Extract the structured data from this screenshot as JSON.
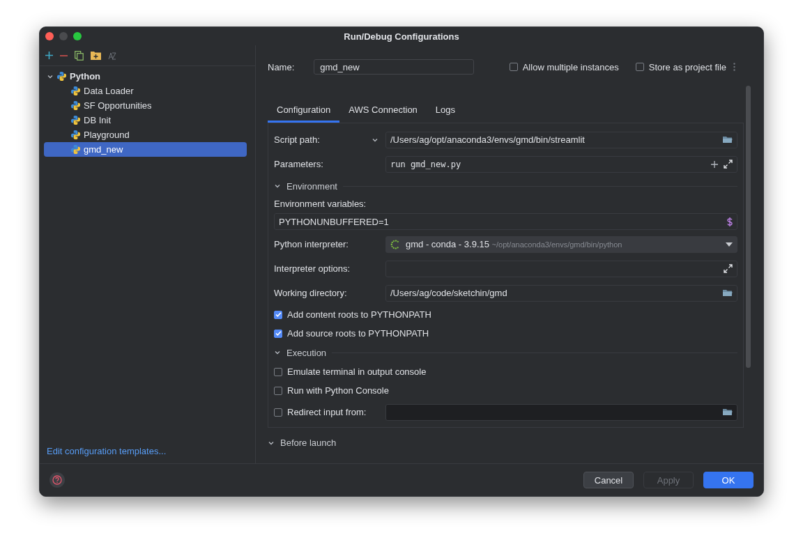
{
  "window": {
    "title": "Run/Debug Configurations"
  },
  "tree": [
    {
      "label": "Python",
      "expanded": true,
      "children": [
        {
          "label": "Data Loader",
          "selected": false
        },
        {
          "label": "SF Opportunities",
          "selected": false
        },
        {
          "label": "DB Init",
          "selected": false
        },
        {
          "label": "Playground",
          "selected": false
        },
        {
          "label": "gmd_new",
          "selected": true
        }
      ]
    }
  ],
  "templates_link": "Edit configuration templates...",
  "name_field": {
    "label": "Name:",
    "value": "gmd_new"
  },
  "options": [
    {
      "label": "Allow multiple instances",
      "checked": false
    },
    {
      "label": "Store as project file",
      "checked": false
    }
  ],
  "tabs": [
    {
      "label": "Configuration",
      "selected": true
    },
    {
      "label": "AWS Connection",
      "selected": false
    },
    {
      "label": "Logs",
      "selected": false
    }
  ],
  "form": [
    {
      "kind": "script",
      "label": "Script path:",
      "value": "/Users/ag/opt/anaconda3/envs/gmd/bin/streamlit"
    },
    {
      "kind": "params",
      "label": "Parameters:",
      "value": "run gmd_new.py"
    },
    {
      "kind": "section",
      "label": "Environment",
      "expanded": true
    },
    {
      "kind": "caption",
      "label": "Environment variables:"
    },
    {
      "kind": "env",
      "value": "PYTHONUNBUFFERED=1"
    },
    {
      "kind": "interpreter",
      "label": "Python interpreter:",
      "value": "gmd - conda - 3.9.15",
      "detail": "~/opt/anaconda3/envs/gmd/bin/python"
    },
    {
      "kind": "expand",
      "label": "Interpreter options:"
    },
    {
      "kind": "path",
      "label": "Working directory:",
      "value": "/Users/ag/code/sketchin/gmd"
    },
    {
      "kind": "check",
      "label": "Add content roots to PYTHONPATH",
      "checked": true
    },
    {
      "kind": "check",
      "label": "Add source roots to PYTHONPATH",
      "checked": true
    },
    {
      "kind": "section",
      "label": "Execution",
      "expanded": true
    },
    {
      "kind": "check",
      "label": "Emulate terminal in output console",
      "checked": false
    },
    {
      "kind": "check",
      "label": "Run with Python Console",
      "checked": false
    },
    {
      "kind": "checkpath",
      "label": "Redirect input from:",
      "checked": false
    }
  ],
  "after_section": {
    "label": "Before launch",
    "expanded": true
  },
  "buttons": [
    {
      "label": "Cancel",
      "kind": "default"
    },
    {
      "label": "Apply",
      "kind": "disabled"
    },
    {
      "label": "OK",
      "kind": "primary"
    }
  ]
}
